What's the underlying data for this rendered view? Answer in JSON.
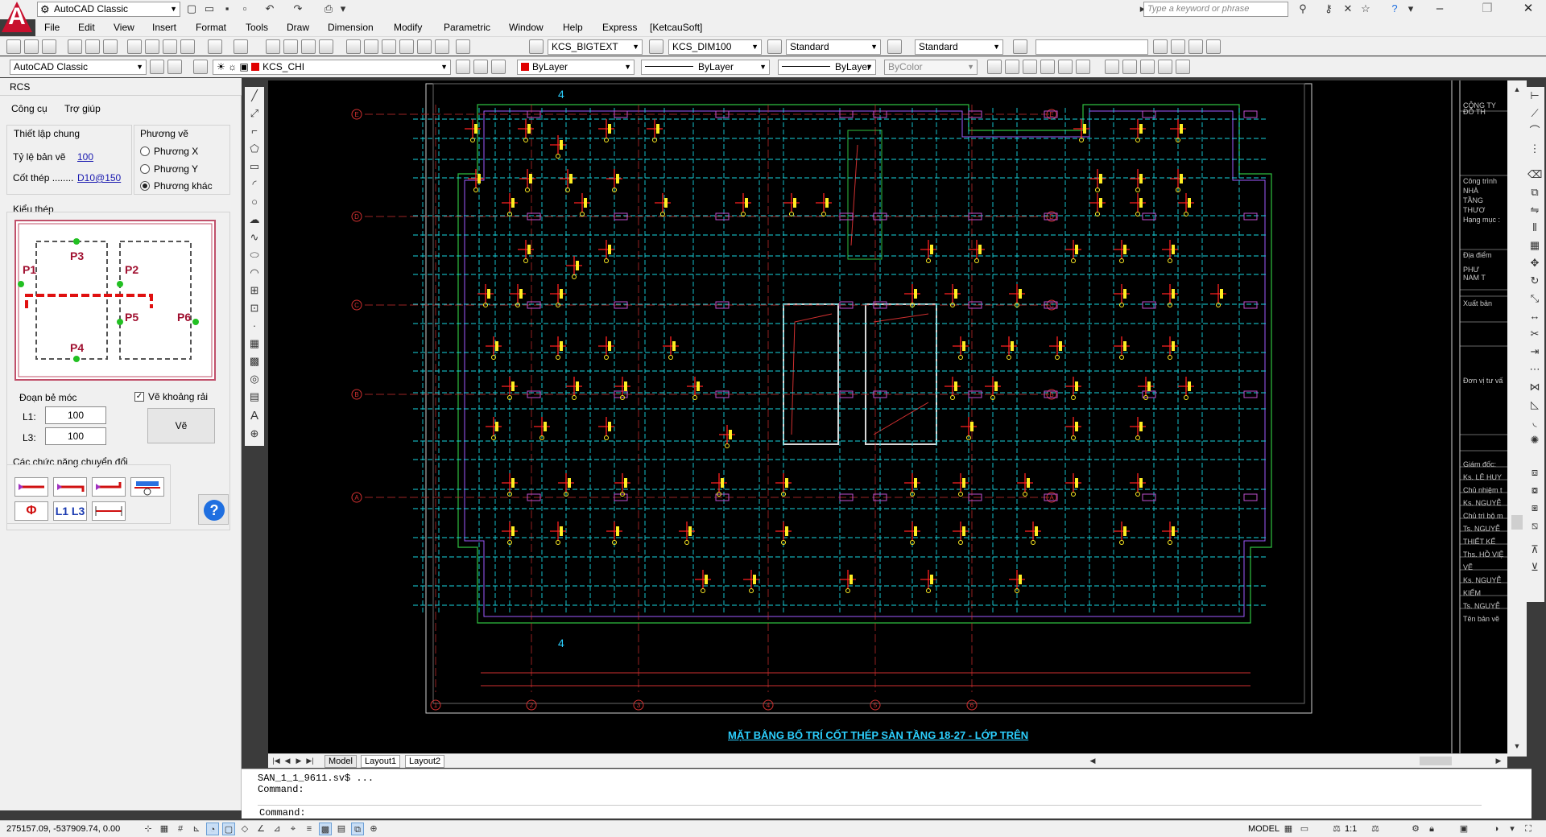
{
  "app": {
    "logo_letter": "A",
    "workspace": "AutoCAD Classic",
    "search_placeholder": "Type a keyword or phrase"
  },
  "menu": [
    "File",
    "Edit",
    "View",
    "Insert",
    "Format",
    "Tools",
    "Draw",
    "Dimension",
    "Modify",
    "Parametric",
    "Window",
    "Help",
    "Express",
    "[KetcauSoft]"
  ],
  "toolbar": {
    "text_style": "KCS_BIGTEXT",
    "dim_style": "KCS_DIM100",
    "table_style": "Standard",
    "multileader_style": "Standard",
    "workspace2": "AutoCAD Classic",
    "layer": "KCS_CHI",
    "color": "ByLayer",
    "linetype": "ByLayer",
    "lineweight": "ByLayer",
    "plotstyle": "ByColor"
  },
  "rcs": {
    "title": "RCS",
    "menu_tools": "Công cụ",
    "menu_help": "Trợ giúp",
    "general_settings": "Thiết lập chung",
    "scale_label": "Tỷ lệ bản vẽ",
    "scale_value": "100",
    "rebar_label": "Cốt thép ........",
    "rebar_value": "D10@150",
    "direction_group": "Phương vẽ",
    "dir_x": "Phương X",
    "dir_y": "Phương Y",
    "dir_other": "Phương khác",
    "steel_type": "Kiểu thép",
    "p_labels": [
      "P1",
      "P2",
      "P3",
      "P4",
      "P5",
      "P6"
    ],
    "hook_label": "Đoạn bẻ móc",
    "l1_label": "L1:",
    "l1_value": "100",
    "l3_label": "L3:",
    "l3_value": "100",
    "spread_label": "Vẽ khoảng rải",
    "draw_button": "Vẽ",
    "convert_group": "Các chức năng chuyển đổi",
    "phi_button": "Φ",
    "l1l3_button": "L1 L3",
    "help_button": "?"
  },
  "drawing": {
    "title": "MẶT BẰNG BỐ TRÍ CỐT THÉP SÀN TẦNG 18-27 - LỚP TRÊN",
    "grid_rows": [
      "E",
      "D",
      "C",
      "B",
      "A"
    ],
    "grid_cols": [
      "1",
      "2",
      "3",
      "4",
      "5",
      "6"
    ],
    "section_mark": "4",
    "title_block": [
      "CÔNG TY",
      "ĐỖ TH",
      "Công trình",
      "NHÀ",
      "TẦNG",
      "THƯƠ",
      "Hạng mục :",
      "Địa điểm",
      "PHƯ",
      "NAM T",
      "Xuất bản",
      "Đơn vị tư vấ",
      "Giám đốc:",
      "Ks. LÊ HUY",
      "Chủ nhiệm t",
      "Ks. NGUYỄ",
      "Chủ trì bộ m",
      "Ts. NGUYỄ",
      "THIẾT KẾ",
      "Ths. HỒ VIỆ",
      "VẼ",
      "Ks. NGUYỄ",
      "KIỂM",
      "Ts. NGUYỄ",
      "Tên bản vẽ"
    ]
  },
  "tabs": [
    "Model",
    "Layout1",
    "Layout2"
  ],
  "command": {
    "line1": "SAN_1_1_9611.sv$ ...",
    "line2": "Command:",
    "prompt": "Command:"
  },
  "status": {
    "coords": "275157.09, -537909.74, 0.00",
    "model": "MODEL",
    "scale": "1:1"
  },
  "colors": {
    "accent_red": "#c8102e",
    "canvas_bg": "#000000",
    "cyan": "#2cd0ff",
    "help_blue": "#1f6fe0"
  }
}
